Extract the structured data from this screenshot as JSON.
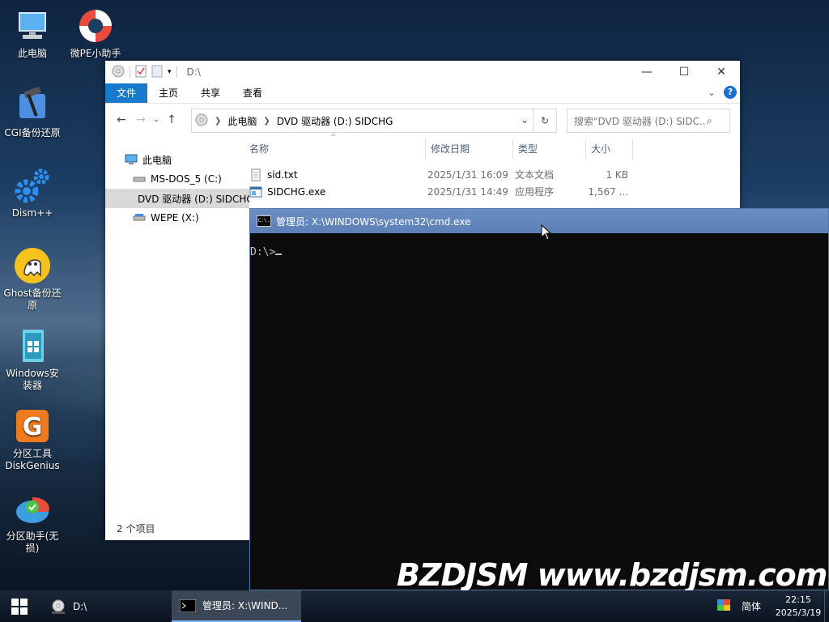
{
  "desktop": {
    "icons": [
      {
        "label": "此电脑",
        "icon": "computer-icon"
      },
      {
        "label": "微PE小助手",
        "icon": "lifebuoy-icon"
      },
      {
        "label": "CGI备份还原",
        "icon": "hammer-icon"
      },
      {
        "label": "Dism++",
        "icon": "gear-icon"
      },
      {
        "label": "Ghost备份还原",
        "icon": "ghost-icon"
      },
      {
        "label": "Windows安装器",
        "icon": "windows-installer-icon"
      },
      {
        "label": "分区工具DiskGenius",
        "icon": "diskgenius-icon"
      },
      {
        "label": "分区助手(无损)",
        "icon": "partition-assistant-icon"
      }
    ]
  },
  "explorer": {
    "title": "D:\\",
    "ribbon_tabs": [
      "文件",
      "主页",
      "共享",
      "查看"
    ],
    "address": {
      "root": "此电脑",
      "current": "DVD 驱动器 (D:) SIDCHG"
    },
    "search_placeholder": "搜索\"DVD 驱动器 (D:) SIDC...",
    "nav": [
      {
        "label": "此电脑"
      },
      {
        "label": "MS-DOS_5 (C:)"
      },
      {
        "label": "DVD 驱动器 (D:) SIDCHG"
      },
      {
        "label": "WEPE (X:)"
      }
    ],
    "columns": [
      "名称",
      "修改日期",
      "类型",
      "大小"
    ],
    "files": [
      {
        "name": "sid.txt",
        "date": "2025/1/31 16:09",
        "type": "文本文档",
        "size": "1 KB"
      },
      {
        "name": "SIDCHG.exe",
        "date": "2025/1/31 14:49",
        "type": "应用程序",
        "size": "1,567 ..."
      }
    ],
    "status": "2 个项目"
  },
  "cmd": {
    "title": "管理员: X:\\WINDOWS\\system32\\cmd.exe",
    "icon_text": "C:\\.",
    "prompt": "D:\\>"
  },
  "watermark": "BZDJSM www.bzdjsm.com",
  "taskbar": {
    "items": [
      {
        "label": "D:\\"
      },
      {
        "label": "管理员: X:\\WIND..."
      }
    ],
    "ime": "简体",
    "time": "22:15",
    "date": "2025/3/19"
  },
  "colors": {
    "accent": "#1979ca",
    "cmd_title": "#5c80b6",
    "taskbar": "#0b1420"
  }
}
